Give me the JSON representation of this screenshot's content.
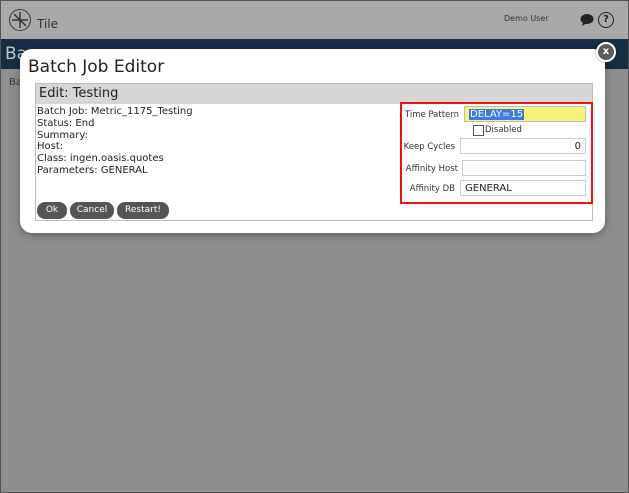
{
  "app": {
    "title": "Tile",
    "user": "Demo User",
    "nav_text": "Ba",
    "sub_text": "Ba"
  },
  "modal": {
    "title": "Batch Job Editor",
    "close_label": "x",
    "panel_title": "Edit: Testing",
    "info": [
      "Batch Job: Metric_1175_Testing",
      "Status: End",
      "Summary:",
      "Host:",
      "Class: ingen.oasis.quotes",
      "Parameters: GENERAL"
    ],
    "buttons": {
      "ok": "Ok",
      "cancel": "Cancel",
      "restart": "Restart!"
    },
    "form": {
      "time_pattern": {
        "label": "Time Pattern",
        "value": "DELAY=15"
      },
      "disabled": {
        "label": "Disabled",
        "checked": false
      },
      "keep_cycles": {
        "label": "Keep Cycles",
        "value": "0"
      },
      "affinity_host": {
        "label": "Affinity Host",
        "value": ""
      },
      "affinity_db": {
        "label": "Affinity DB",
        "value": "GENERAL"
      }
    }
  },
  "icons": {
    "logo": "tile-logo-icon",
    "chat": "chat-icon",
    "help": "help-icon",
    "close": "close-icon"
  },
  "colors": {
    "navbar": "#152e45",
    "highlight": "#e11111",
    "field_highlight": "#f8f27a",
    "selection": "#3b7ae0"
  }
}
